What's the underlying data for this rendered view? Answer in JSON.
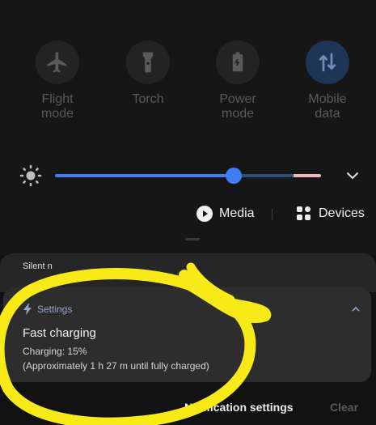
{
  "quick_settings": {
    "tiles": [
      {
        "label_line1": "Flight",
        "label_line2": "mode",
        "icon": "airplane-icon"
      },
      {
        "label_line1": "Torch",
        "label_line2": "",
        "icon": "torch-icon"
      },
      {
        "label_line1": "Power",
        "label_line2": "mode",
        "icon": "power-mode-icon"
      },
      {
        "label_line1": "Mobile",
        "label_line2": "data",
        "icon": "mobile-data-icon"
      }
    ]
  },
  "brightness": {
    "icon": "sun-icon",
    "level": 0.68,
    "expand_icon": "chevron-down-icon"
  },
  "media_row": {
    "media_label": "Media",
    "devices_label": "Devices"
  },
  "notifications": {
    "silent_header": "Silent n",
    "card": {
      "app_name": "Settings",
      "title": "Fast charging",
      "line1": "Charging: 15%",
      "line2": "(Approximately 1 h 27 m until fully charged)"
    }
  },
  "footer": {
    "settings_label": "Notification settings",
    "clear_label": "Clear"
  },
  "colors": {
    "accent": "#3d7ef3",
    "highlight": "#f7ea16"
  }
}
